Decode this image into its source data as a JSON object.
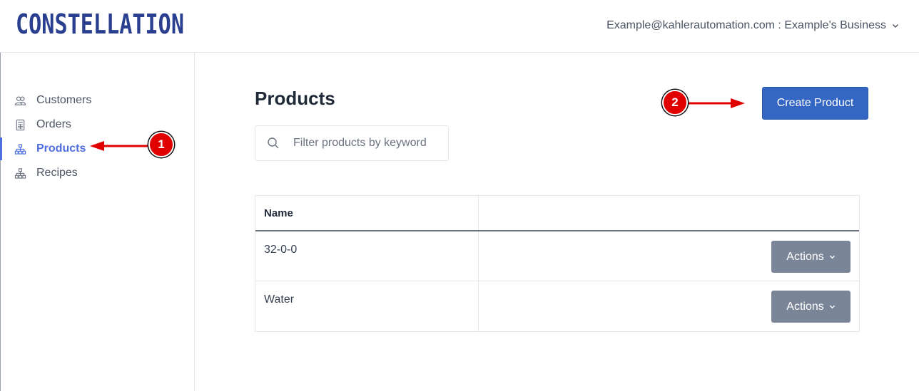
{
  "app": {
    "logo_text": "CONSTELLATION"
  },
  "header": {
    "account_label": "Example@kahlerautomation.com : Example's Business"
  },
  "sidebar": {
    "items": [
      {
        "label": "Customers",
        "icon": "users-icon",
        "active": false
      },
      {
        "label": "Orders",
        "icon": "calculator-icon",
        "active": false
      },
      {
        "label": "Products",
        "icon": "hierarchy-icon",
        "active": true
      },
      {
        "label": "Recipes",
        "icon": "hierarchy-icon",
        "active": false
      }
    ]
  },
  "main": {
    "title": "Products",
    "create_button_label": "Create Product",
    "filter": {
      "placeholder": "Filter products by keyword",
      "value": ""
    },
    "table": {
      "columns": [
        "Name",
        ""
      ],
      "rows": [
        {
          "name": "32-0-0",
          "action_label": "Actions"
        },
        {
          "name": "Water",
          "action_label": "Actions"
        }
      ]
    }
  },
  "annotations": [
    {
      "number": "1"
    },
    {
      "number": "2"
    }
  ],
  "colors": {
    "brand": "#2a3f8f",
    "accent": "#4f6fe0",
    "primary_button": "#3466c4",
    "secondary_button": "#7a8598",
    "annotation_red": "#e00000"
  }
}
